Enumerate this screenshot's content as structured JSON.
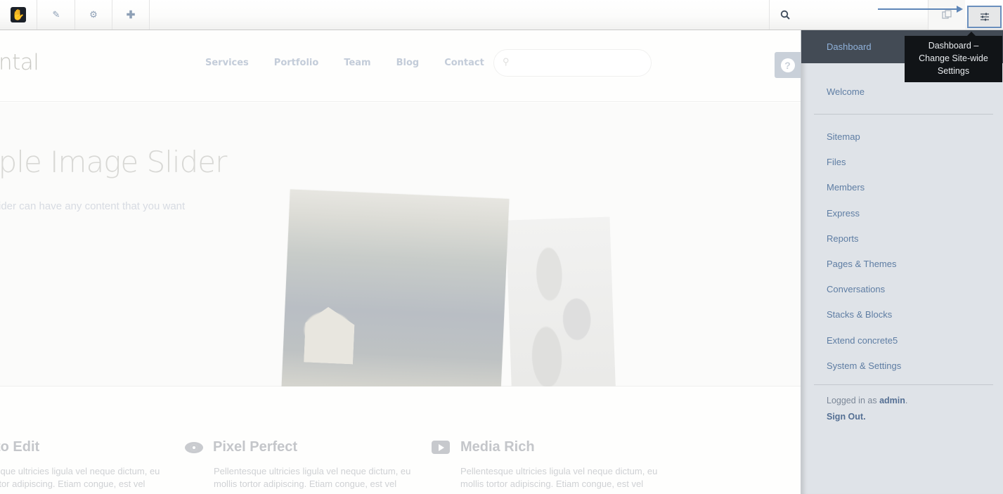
{
  "toolbar": {
    "logo_icon": "concrete5-hand-logo",
    "edit_icon": "pencil-icon",
    "settings_icon": "gear-icon",
    "add_icon": "plus-icon",
    "search_icon": "search-icon",
    "intelligent_search_icon": "copy-pages-icon",
    "dashboard_icon": "sliders-icon",
    "accent_color": "#6a8fbd"
  },
  "tooltip": {
    "text_line1": "Dashboard –",
    "text_line2": "Change Site-wide",
    "text_line3": "Settings"
  },
  "site": {
    "brand_text": "ntal",
    "nav": [
      "Services",
      "Portfolio",
      "Team",
      "Blog",
      "Contact"
    ],
    "search_placeholder": "",
    "help_label": "?",
    "hero_title": "nple Image Slider",
    "hero_subtitle": "ider can have any content that you want",
    "features": [
      {
        "icon": "edit-icon",
        "title": "to Edit",
        "text": "sque ultricies ligula vel neque dictum, eu rtor adipiscing. Etiam congue, est vel"
      },
      {
        "icon": "eye-icon",
        "title": "Pixel Perfect",
        "text": "Pellentesque ultricies ligula vel neque dictum, eu mollis tortor adipiscing. Etiam congue, est vel"
      },
      {
        "icon": "play-icon",
        "title": "Media Rich",
        "text": "Pellentesque ultricies ligula vel neque dictum, eu mollis tortor adipiscing. Etiam congue, est vel"
      }
    ]
  },
  "panel": {
    "header": "Dashboard",
    "welcome": "Welcome",
    "items": [
      "Sitemap",
      "Files",
      "Members",
      "Express",
      "Reports",
      "Pages & Themes",
      "Conversations",
      "Stacks & Blocks",
      "Extend concrete5",
      "System & Settings"
    ],
    "logged_in_prefix": "Logged in as ",
    "username": "admin",
    "logged_in_suffix": ".",
    "sign_out": "Sign Out."
  }
}
